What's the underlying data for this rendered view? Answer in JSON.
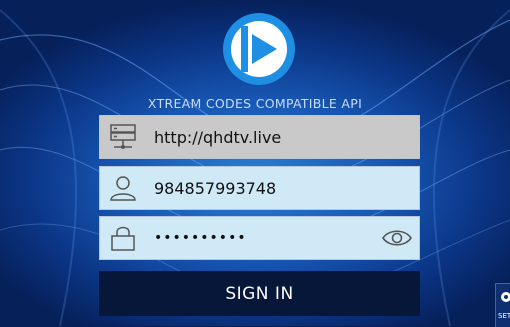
{
  "app": {
    "api_label": "XTREAM CODES COMPATIBLE API"
  },
  "form": {
    "server": {
      "value": "http://qhdtv.live",
      "icon": "server-icon"
    },
    "username": {
      "value": "984857993748",
      "icon": "user-icon"
    },
    "password": {
      "value": "••••••••••",
      "icon": "lock-icon",
      "toggle_icon": "eye-icon"
    }
  },
  "buttons": {
    "signin_label": "SIGN IN",
    "settings_label": "SET"
  },
  "colors": {
    "background": "#1756b3",
    "server_field": "#c9c9c9",
    "input_field": "#cfe9f6",
    "signin_button": "#07173a",
    "logo": "#1e8fe3"
  }
}
